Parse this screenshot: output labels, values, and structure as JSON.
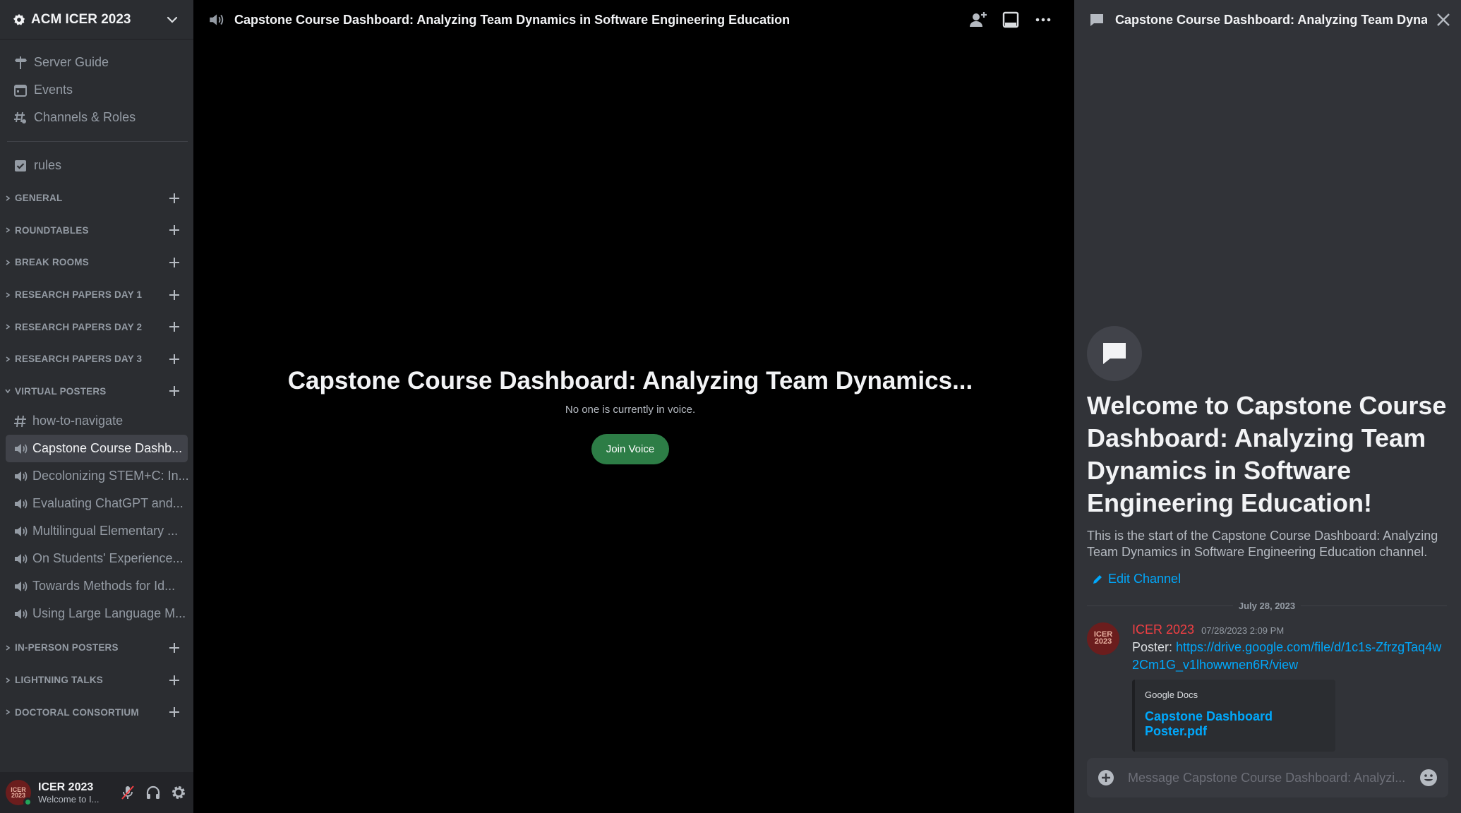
{
  "server": {
    "name": "ACM ICER 2023"
  },
  "guide_items": [
    {
      "label": "Server Guide",
      "icon": "signpost-icon"
    },
    {
      "label": "Events",
      "icon": "calendar-icon"
    },
    {
      "label": "Channels & Roles",
      "icon": "channels-roles-icon"
    }
  ],
  "rules_channel": {
    "label": "rules",
    "icon": "rules-checkbox-icon"
  },
  "categories_top": [
    "GENERAL",
    "ROUNDTABLES",
    "BREAK ROOMS",
    "RESEARCH PAPERS DAY 1",
    "RESEARCH PAPERS DAY 2",
    "RESEARCH PAPERS DAY 3"
  ],
  "virtual_posters": {
    "label": "VIRTUAL POSTERS",
    "channels": [
      {
        "label": "how-to-navigate",
        "type": "text"
      },
      {
        "label": "Capstone Course Dashb...",
        "type": "voice",
        "active": true
      },
      {
        "label": "Decolonizing STEM+C: In...",
        "type": "voice"
      },
      {
        "label": "Evaluating ChatGPT and...",
        "type": "voice"
      },
      {
        "label": "Multilingual Elementary ...",
        "type": "voice"
      },
      {
        "label": "On Students' Experience...",
        "type": "voice"
      },
      {
        "label": "Towards Methods for Id...",
        "type": "voice"
      },
      {
        "label": "Using Large Language M...",
        "type": "voice"
      }
    ]
  },
  "categories_bottom": [
    "IN-PERSON POSTERS",
    "LIGHTNING TALKS",
    "DOCTORAL CONSORTIUM"
  ],
  "user": {
    "name": "ICER 2023",
    "status": "Welcome to I...",
    "avatar_text": "ICER 2023"
  },
  "main": {
    "header_title": "Capstone Course Dashboard: Analyzing Team Dynamics in Software Engineering Education",
    "voice_title": "Capstone Course Dashboard: Analyzing Team Dynamics...",
    "voice_subtitle": "No one is currently in voice.",
    "join_label": "Join Voice"
  },
  "thread": {
    "header_title": "Capstone Course Dashboard: Analyzing Team Dynamics in Software Engineering Education",
    "welcome_title": "Welcome to Capstone Course Dashboard: Analyzing Team Dynamics in Software Engineering Education!",
    "welcome_desc": "This is the start of the Capstone Course Dashboard: Analyzing Team Dynamics in Software Engineering Education channel.",
    "edit_label": "Edit Channel",
    "date_divider": "July 28, 2023",
    "message": {
      "author": "ICER 2023",
      "timestamp": "07/28/2023 2:09 PM",
      "prefix": "Poster: ",
      "link": "https://drive.google.com/file/d/1c1s-ZfrzgTaq4w2Cm1G_v1lhowwnen6R/view",
      "embed_provider": "Google Docs",
      "embed_title": "Capstone Dashboard Poster.pdf"
    },
    "composer_placeholder": "Message Capstone Course Dashboard: Analyzi..."
  },
  "colors": {
    "accent_green": "#2d7d46",
    "link": "#00a8fc",
    "author_red": "#f23f43",
    "status_online": "#23a55a"
  }
}
